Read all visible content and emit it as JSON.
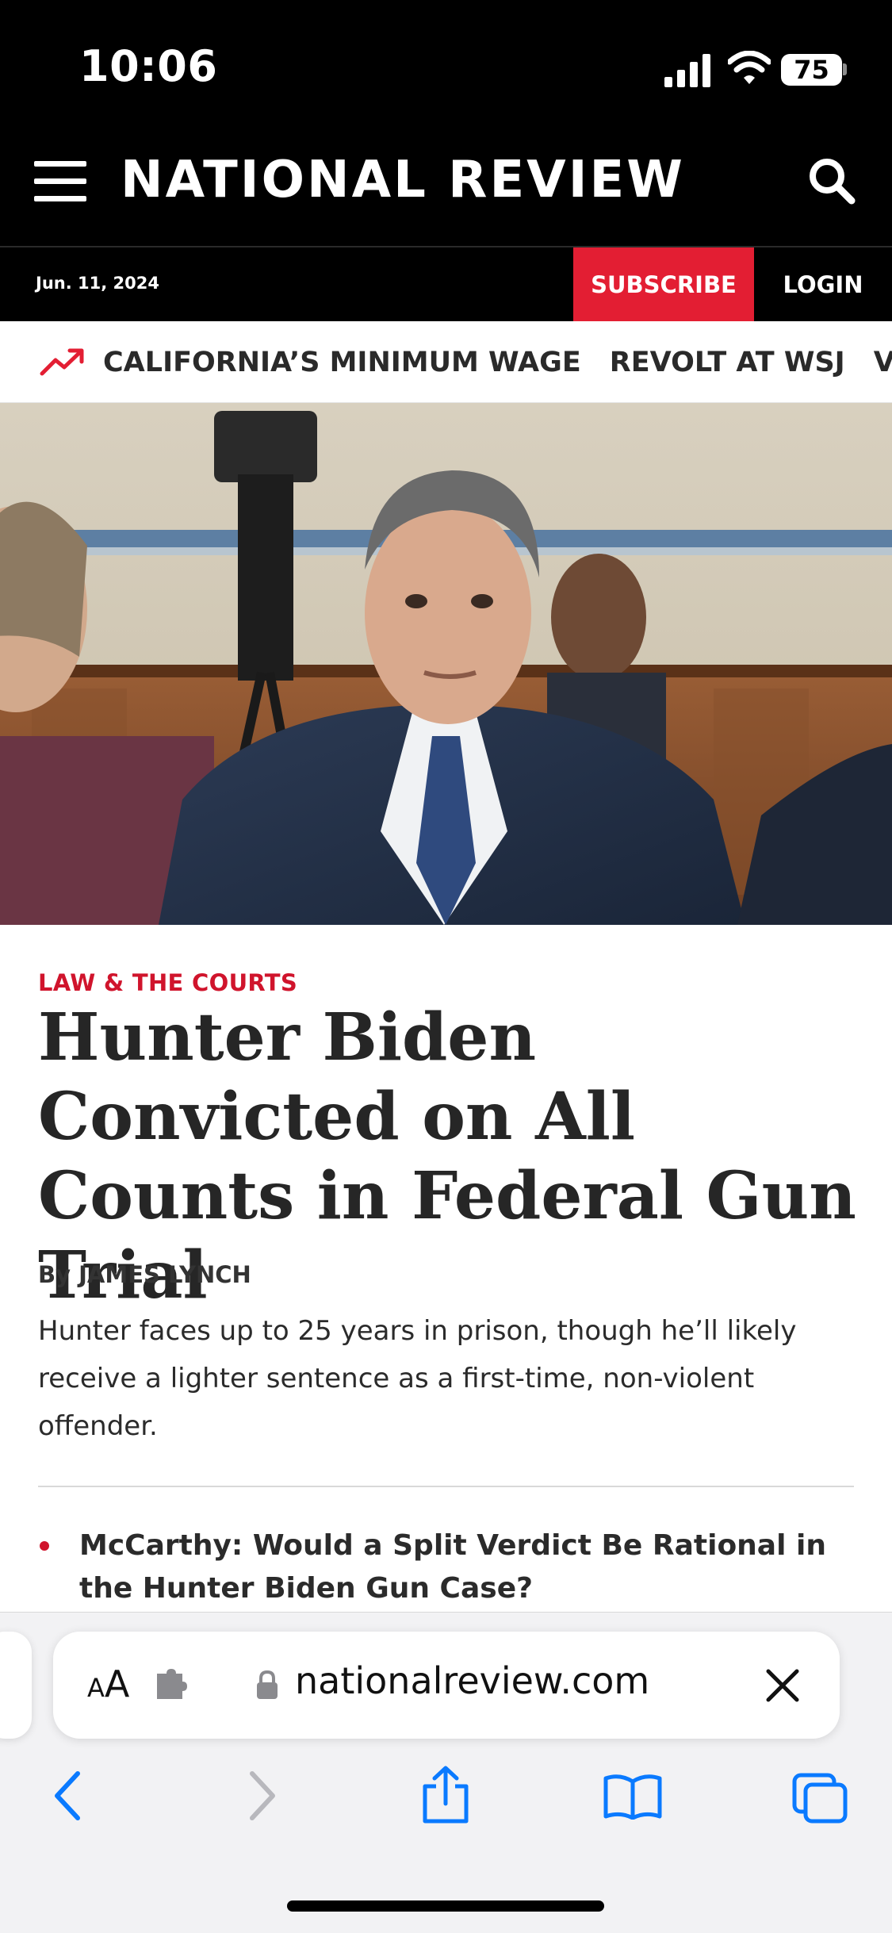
{
  "status_bar": {
    "time": "10:06",
    "battery": "75"
  },
  "header": {
    "logo": "NATIONAL REVIEW"
  },
  "subbar": {
    "date": "Jun. 11, 2024",
    "subscribe_label": "SUBSCRIBE",
    "login_label": "LOGIN"
  },
  "trending": {
    "items": [
      "CALIFORNIA’S MINIMUM WAGE",
      "REVOLT AT WSJ",
      "VAI"
    ]
  },
  "article": {
    "section": "LAW & THE COURTS",
    "headline": "Hunter Biden Convicted on All Counts in Federal Gun Trial",
    "byline": "By JAMES LYNCH",
    "dek": "Hunter faces up to 25 years in prison, though he’ll likely receive a lighter sentence as a first-time, non-violent offender.",
    "related": [
      "McCarthy: Would a Split Verdict Be Rational in the Hunter Biden Gun Case?"
    ]
  },
  "browser": {
    "aa_large": "A",
    "aa_small": "A",
    "url": "nationalreview.com"
  },
  "colors": {
    "brand_red": "#e31e33",
    "header_bg": "#000000",
    "ios_blue": "#0a7aff"
  },
  "icons": {
    "menu": "hamburger-icon",
    "search": "search-icon",
    "trending": "trending-up-icon",
    "extension": "puzzle-icon",
    "lock": "lock-icon",
    "close": "close-icon",
    "back": "chevron-left-icon",
    "forward": "chevron-right-icon",
    "share": "share-icon",
    "bookmarks": "book-icon",
    "tabs": "tabs-icon"
  }
}
